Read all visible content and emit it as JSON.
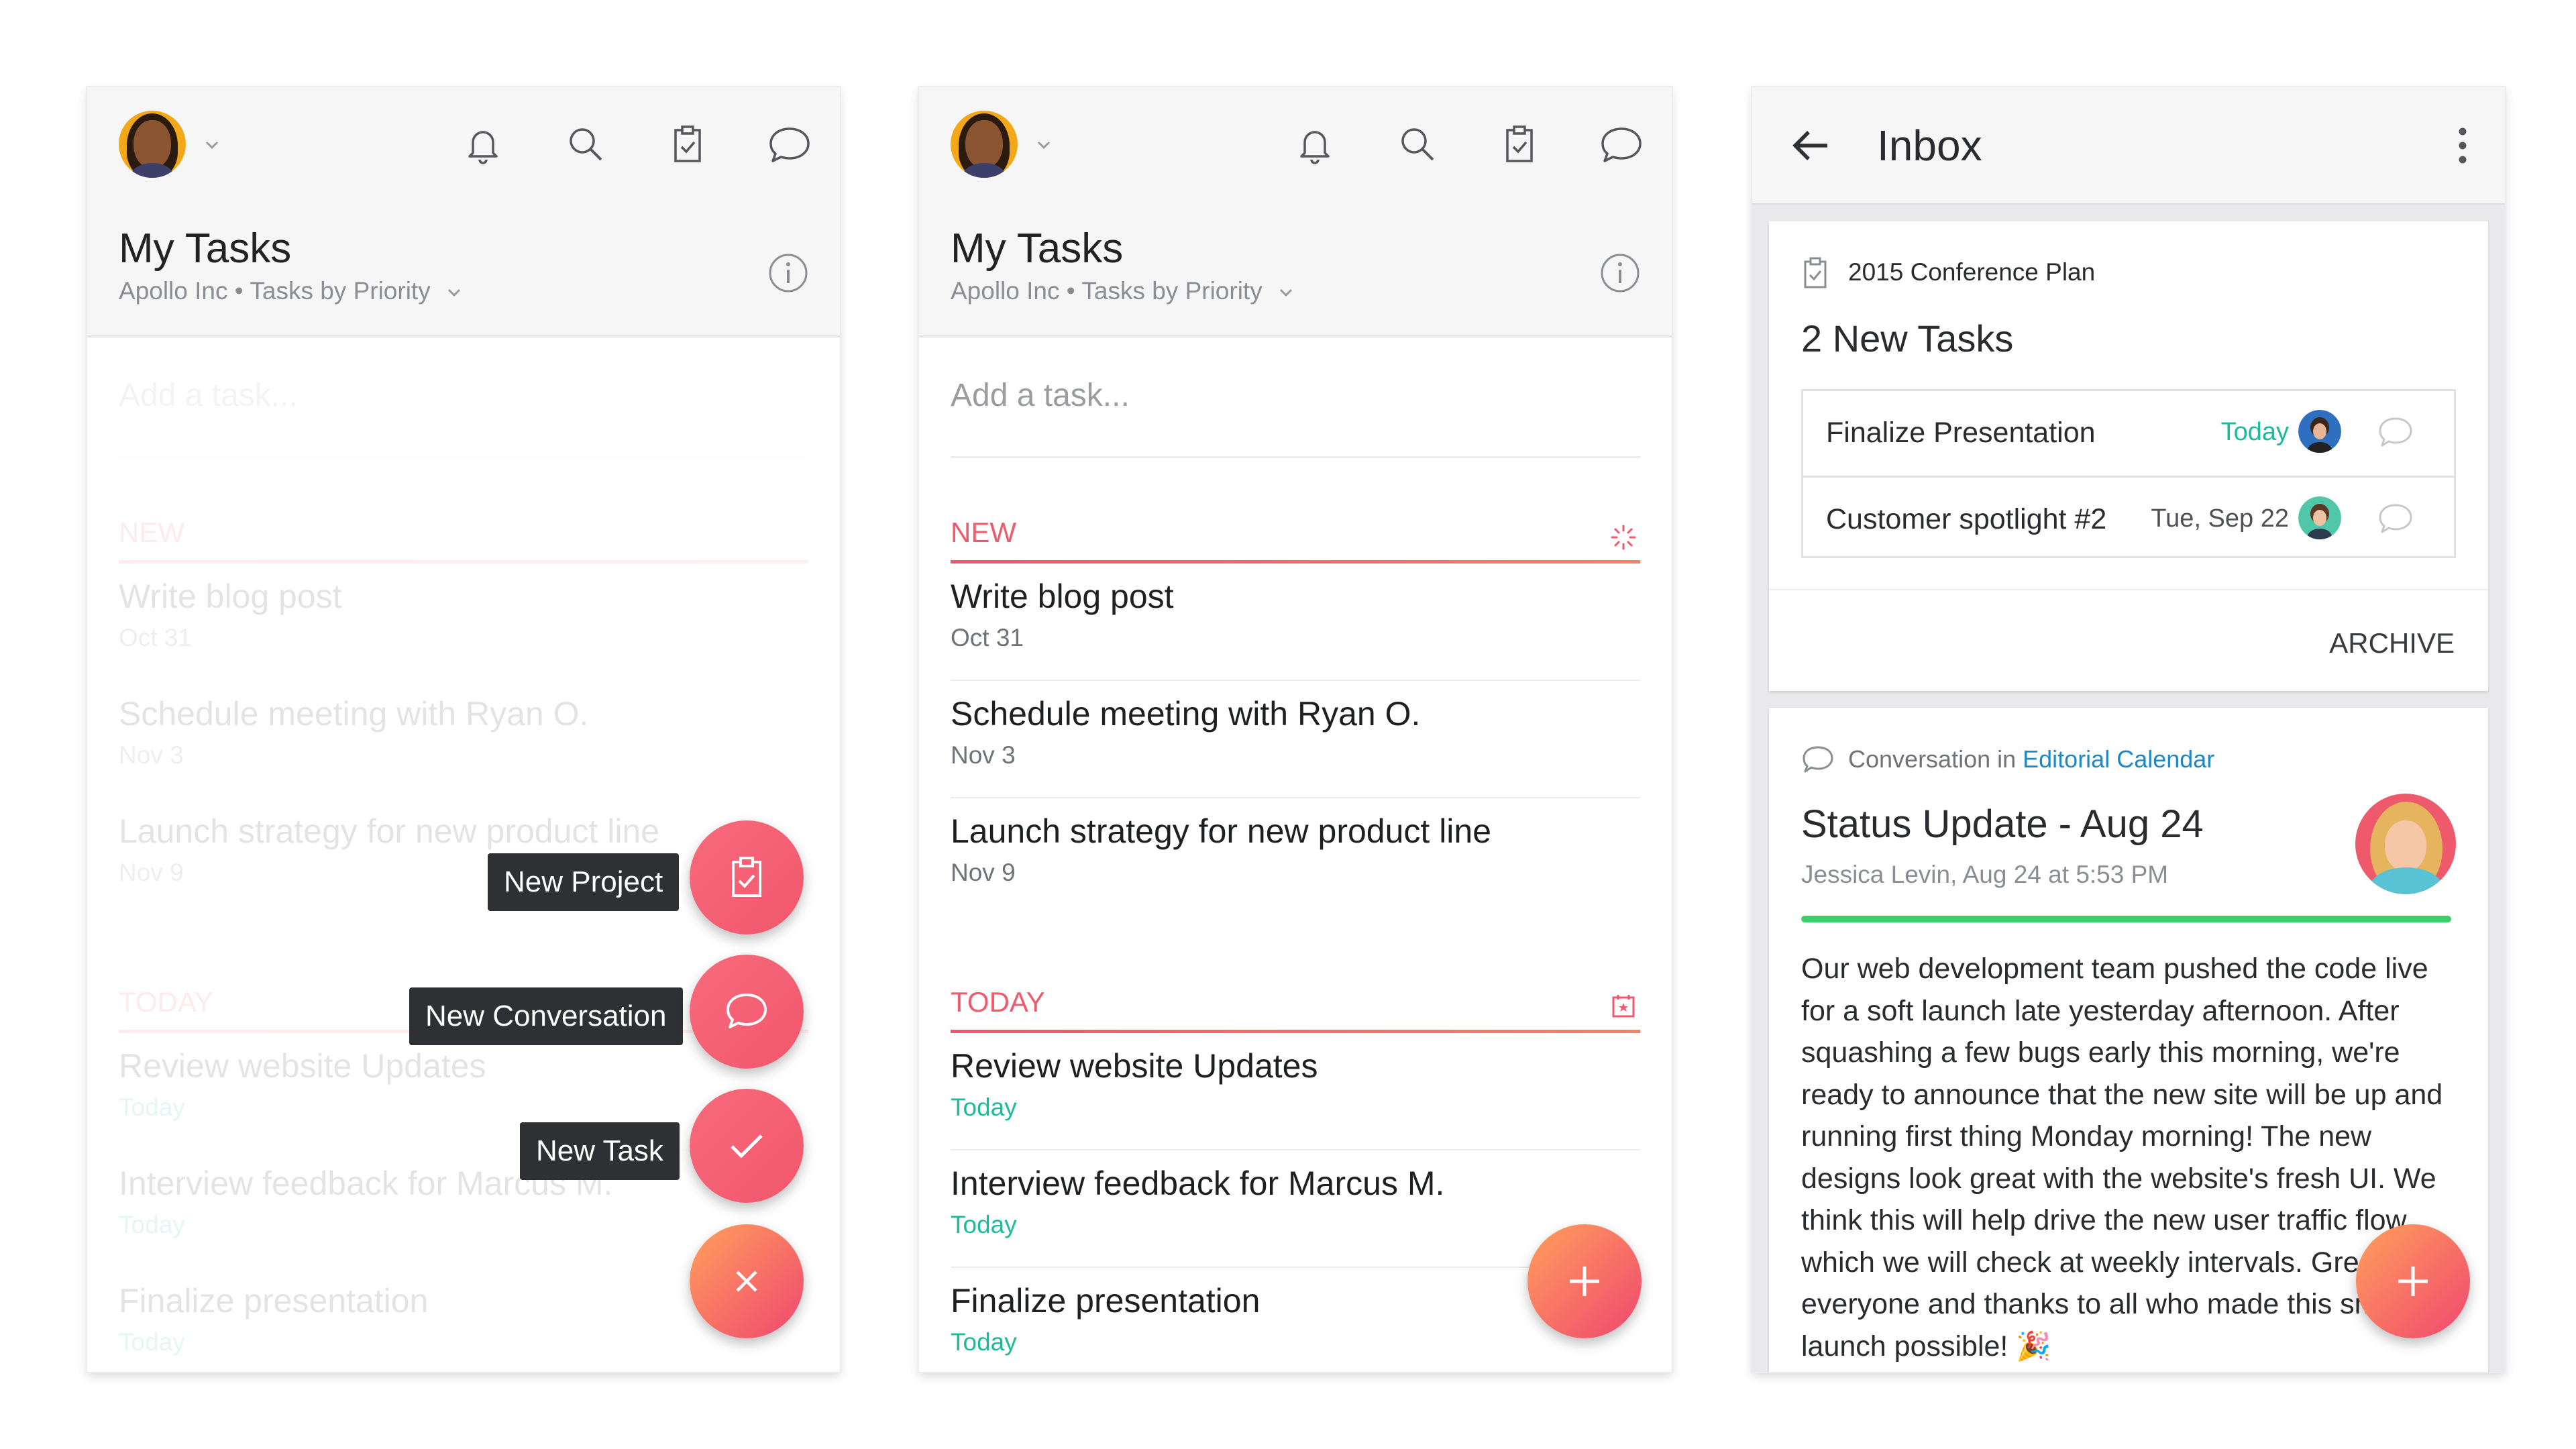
{
  "colors": {
    "accent": "#f2576c",
    "today_green": "#1abc9c",
    "link_blue": "#1e88c7",
    "progress_green": "#3bcf6c",
    "tooltip_bg": "#2f3033"
  },
  "icons": {
    "notifications": "bell-icon",
    "search": "search-icon",
    "my_tasks": "clipboard-check-icon",
    "inbox": "speech-bubble-icon",
    "info": "info-icon",
    "new_project": "clipboard-check-icon",
    "new_conversation": "speech-bubble-icon",
    "new_task": "check-icon",
    "close": "close-icon",
    "add": "plus-icon",
    "back": "back-arrow-icon",
    "more": "more-vertical-icon"
  },
  "task_screen": {
    "title": "My Tasks",
    "workspace": "Apollo Inc",
    "separator": "•",
    "view": "Tasks by Priority",
    "add_task_placeholder": "Add a task...",
    "sections": [
      {
        "label": "NEW",
        "tasks": [
          {
            "name": "Write blog post",
            "date": "Oct 31"
          },
          {
            "name": "Schedule meeting with Ryan O.",
            "date": "Nov 3"
          },
          {
            "name": "Launch strategy for new product line",
            "date": "Nov 9"
          }
        ]
      },
      {
        "label": "TODAY",
        "tasks": [
          {
            "name": "Review website Updates",
            "date": "Today"
          },
          {
            "name": "Interview feedback for Marcus M.",
            "date": "Today"
          },
          {
            "name": "Finalize presentation",
            "date": "Today"
          }
        ]
      }
    ]
  },
  "fab_menu": {
    "new_project": "New Project",
    "new_conversation": "New Conversation",
    "new_task": "New Task",
    "close_symbol": "×"
  },
  "inbox": {
    "title": "Inbox",
    "task_card": {
      "project": "2015 Conference Plan",
      "heading": "2 New Tasks",
      "tasks": [
        {
          "name": "Finalize Presentation",
          "date": "Today"
        },
        {
          "name": "Customer spotlight #2",
          "date": "Tue, Sep 22"
        }
      ],
      "archive_label": "ARCHIVE"
    },
    "conversation_card": {
      "prefix": "Conversation in ",
      "project": "Editorial Calendar",
      "title": "Status Update - Aug 24",
      "meta": "Jessica Levin, Aug 24 at 5:53 PM",
      "body": "Our web development team pushed the code live for a soft launch late yesterday afternoon. After squashing a few bugs early this morning, we're ready to announce that the new site will be up and running first thing Monday morning! The new designs look great with the website's fresh UI. We think this will help drive the new user traffic flow, which we will check at weekly intervals.  Great work everyone and thanks to all who made this smooth launch possible!",
      "emoji": "🎉"
    }
  }
}
